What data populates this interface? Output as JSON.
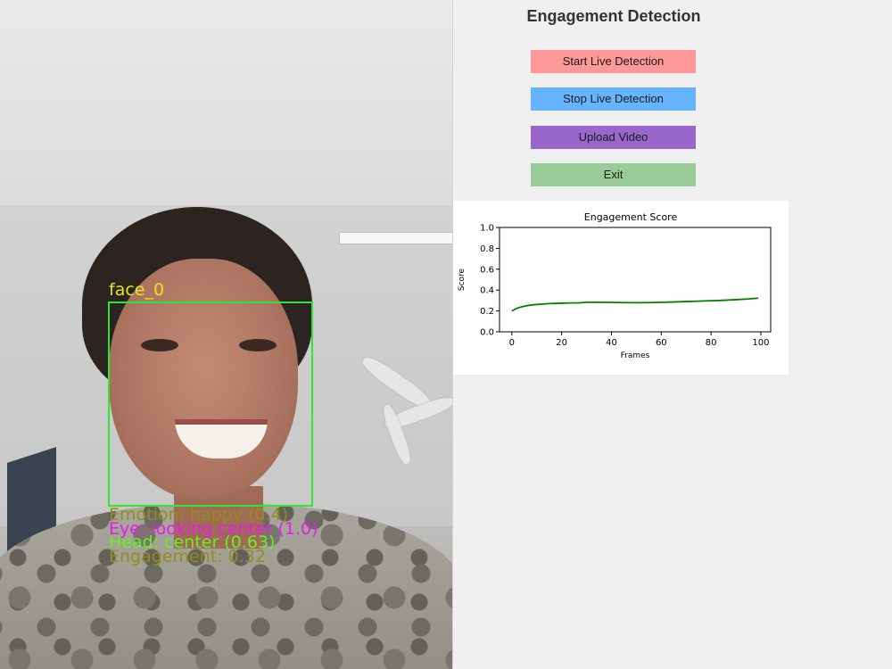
{
  "camera": {
    "face_label": "face_0",
    "emotion": "Emotion: happy (0.4)",
    "eye": "Eye: looking center (1.0)",
    "head": "Head: center (0.63)",
    "engagement": "Engagement: 0.32"
  },
  "panel": {
    "title": "Engagement Detection",
    "buttons": {
      "start": {
        "label": "Start Live Detection",
        "color": "#ff9999"
      },
      "stop": {
        "label": "Stop Live Detection",
        "color": "#66b3ff"
      },
      "upload": {
        "label": "Upload Video",
        "color": "#9966cc"
      },
      "exit": {
        "label": "Exit",
        "color": "#99cc99"
      }
    }
  },
  "chart_data": {
    "type": "line",
    "title": "Engagement Score",
    "xlabel": "Frames",
    "ylabel": "Score",
    "xlim": [
      -4.95,
      103.95
    ],
    "ylim": [
      0.0,
      1.0
    ],
    "xticks": [
      0,
      20,
      40,
      60,
      80,
      100
    ],
    "yticks": [
      0.0,
      0.2,
      0.4,
      0.6,
      0.8,
      1.0
    ],
    "grid": false,
    "series": [
      {
        "color": "#008000",
        "x": [
          0,
          2,
          4,
          6,
          8,
          10,
          12,
          15,
          18,
          21,
          24,
          27,
          30,
          35,
          40,
          45,
          50,
          55,
          60,
          65,
          70,
          75,
          80,
          85,
          90,
          95,
          99
        ],
        "y": [
          0.2,
          0.225,
          0.24,
          0.25,
          0.258,
          0.262,
          0.266,
          0.27,
          0.273,
          0.275,
          0.277,
          0.278,
          0.283,
          0.283,
          0.282,
          0.28,
          0.279,
          0.28,
          0.283,
          0.286,
          0.29,
          0.294,
          0.298,
          0.302,
          0.308,
          0.315,
          0.323
        ]
      }
    ]
  }
}
